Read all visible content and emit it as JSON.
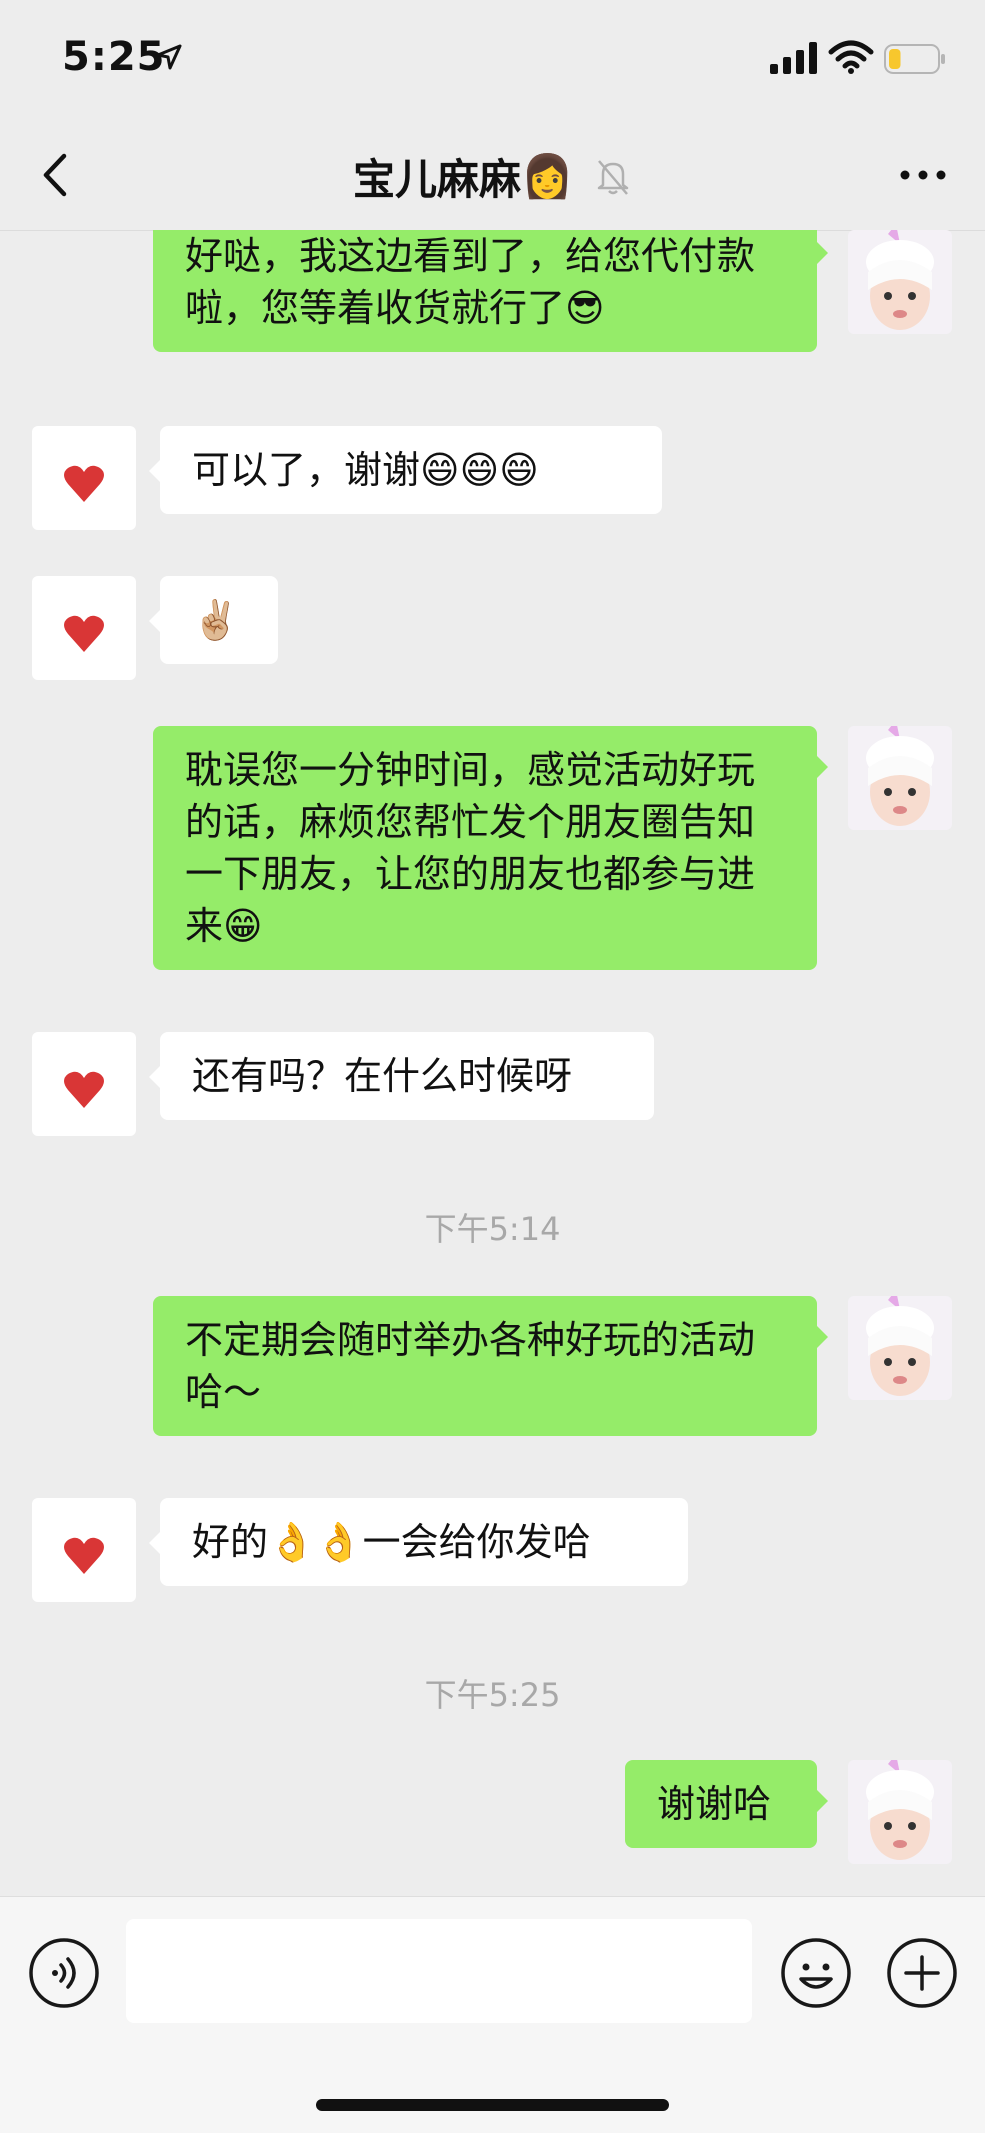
{
  "status_bar": {
    "time": "5:25",
    "battery_level": 0.25
  },
  "header": {
    "title": "宝儿麻麻",
    "title_emoji": "👩"
  },
  "messages": [
    {
      "sender": "self",
      "text": "好哒，我这边看到了，给您代付款啦，您等着收货就行了😎"
    },
    {
      "sender": "other",
      "text": "可以了，谢谢😄😄😄"
    },
    {
      "sender": "other",
      "text": "✌🏼"
    },
    {
      "sender": "self",
      "text": "耽误您一分钟时间，感觉活动好玩的话，麻烦您帮忙发个朋友圈告知一下朋友，让您的朋友也都参与进来😁"
    },
    {
      "sender": "other",
      "text": "还有吗？在什么时候呀"
    },
    {
      "type": "timestamp",
      "text": "下午5:14"
    },
    {
      "sender": "self",
      "text": "不定期会随时举办各种好玩的活动哈～"
    },
    {
      "sender": "other",
      "text": "好的👌👌一会给你发哈"
    },
    {
      "type": "timestamp",
      "text": "下午5:25"
    },
    {
      "sender": "self",
      "text": "谢谢哈"
    }
  ],
  "input_bar": {
    "value": ""
  },
  "colors": {
    "self_bubble": "#95ec69",
    "other_bubble": "#ffffff",
    "background": "#ededed"
  }
}
